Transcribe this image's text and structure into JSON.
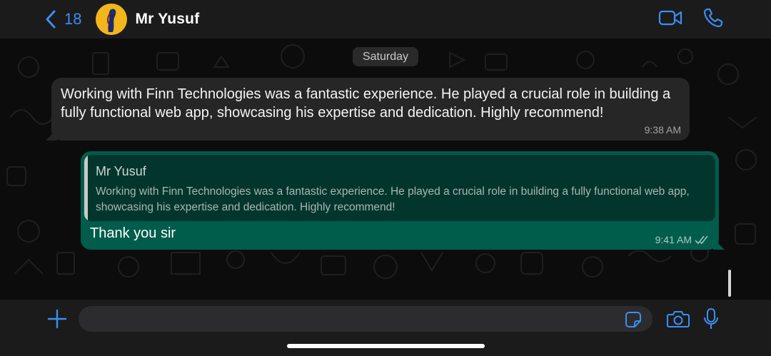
{
  "header": {
    "back_count": "18",
    "contact_name": "Mr Yusuf",
    "icons": [
      "back-chevron-icon",
      "video-call-icon",
      "phone-call-icon"
    ]
  },
  "chat": {
    "date_separator": "Saturday",
    "messages": [
      {
        "direction": "incoming",
        "text": "Working with Finn Technologies was a fantastic experience. He played a crucial role in building a fully functional web app, showcasing his expertise and dedication. Highly recommend!",
        "time": "9:38 AM"
      },
      {
        "direction": "outgoing",
        "reply_to": {
          "author": "Mr Yusuf",
          "text": "Working with Finn Technologies was a fantastic experience. He played a crucial role in building a fully functional web app, showcasing his expertise and dedication. Highly recommend!"
        },
        "text": "Thank you sir",
        "time": "9:41 AM",
        "status": "read"
      }
    ]
  },
  "composer": {
    "placeholder": "",
    "icons": [
      "plus-icon",
      "sticker-icon",
      "camera-icon",
      "microphone-icon"
    ]
  },
  "colors": {
    "accent": "#3b8ff2",
    "outgoing_bubble": "#005c4b",
    "incoming_bubble": "#262626",
    "header_bg": "#1b1b1b",
    "avatar_bg": "#f2b61c"
  }
}
